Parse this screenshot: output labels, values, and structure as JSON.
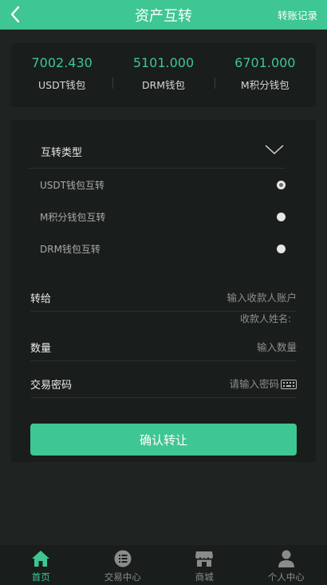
{
  "header": {
    "title": "资产互转",
    "record_link": "转账记录"
  },
  "wallets": [
    {
      "amount": "7002.430",
      "label": "USDT钱包"
    },
    {
      "amount": "5101.000",
      "label": "DRM钱包"
    },
    {
      "amount": "6701.000",
      "label": "M积分钱包"
    }
  ],
  "transfer_type": {
    "label": "互转类型",
    "options": [
      {
        "label": "USDT钱包互转",
        "selected": true
      },
      {
        "label": "M积分钱包互转",
        "selected": false
      },
      {
        "label": "DRM钱包互转",
        "selected": false
      }
    ]
  },
  "form": {
    "recipient": {
      "label": "转给",
      "placeholder": "输入收款人账户"
    },
    "payee_name_label": "收款人姓名:",
    "quantity": {
      "label": "数量",
      "placeholder": "输入数量"
    },
    "password": {
      "label": "交易密码",
      "placeholder": "请输入密码"
    },
    "confirm_label": "确认转让"
  },
  "tabbar": [
    {
      "label": "首页",
      "icon": "home-icon",
      "active": true
    },
    {
      "label": "交易中心",
      "icon": "list-icon",
      "active": false
    },
    {
      "label": "商城",
      "icon": "store-icon",
      "active": false
    },
    {
      "label": "个人中心",
      "icon": "user-icon",
      "active": false
    }
  ],
  "colors": {
    "accent": "#3ec693",
    "background": "#1f2321",
    "panel": "#191d1b"
  }
}
